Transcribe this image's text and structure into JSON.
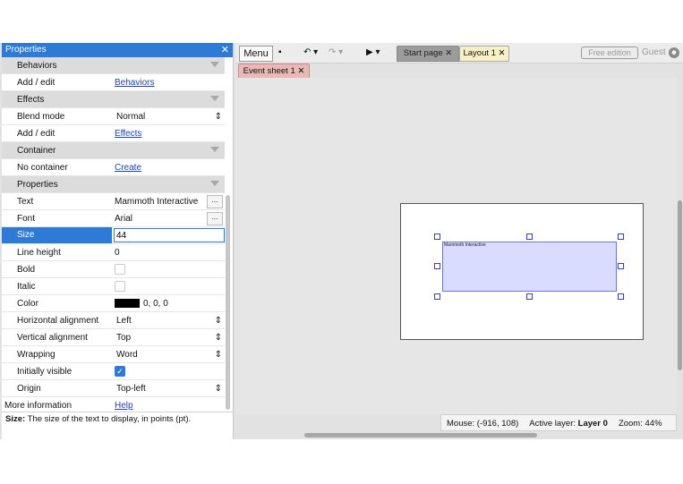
{
  "properties_panel": {
    "title": "Properties",
    "close_icon": "✕",
    "rows": [
      {
        "kind": "section",
        "label": "Behaviors"
      },
      {
        "kind": "link",
        "label": "Add / edit",
        "value": "Behaviors"
      },
      {
        "kind": "section",
        "label": "Effects"
      },
      {
        "kind": "select",
        "label": "Blend mode",
        "value": "Normal"
      },
      {
        "kind": "link",
        "label": "Add / edit",
        "value": "Effects"
      },
      {
        "kind": "section",
        "label": "Container"
      },
      {
        "kind": "link",
        "label": "No container",
        "value": "Create"
      },
      {
        "kind": "section",
        "label": "Properties"
      },
      {
        "kind": "text-ellipsis",
        "label": "Text",
        "value": "Mammoth Interactive"
      },
      {
        "kind": "text-ellipsis",
        "label": "Font",
        "value": "Arial"
      },
      {
        "kind": "input-selected",
        "label": "Size",
        "value": "44"
      },
      {
        "kind": "text",
        "label": "Line height",
        "value": "0"
      },
      {
        "kind": "checkbox",
        "label": "Bold",
        "checked": false
      },
      {
        "kind": "checkbox",
        "label": "Italic",
        "checked": false
      },
      {
        "kind": "color",
        "label": "Color",
        "value": "0, 0, 0"
      },
      {
        "kind": "select",
        "label": "Horizontal alignment",
        "value": "Left"
      },
      {
        "kind": "select",
        "label": "Vertical alignment",
        "value": "Top"
      },
      {
        "kind": "select",
        "label": "Wrapping",
        "value": "Word"
      },
      {
        "kind": "checkbox",
        "label": "Initially visible",
        "checked": true
      },
      {
        "kind": "select",
        "label": "Origin",
        "value": "Top-left"
      },
      {
        "kind": "link-outdent",
        "label": "More information",
        "value": "Help"
      }
    ],
    "description": {
      "term": "Size:",
      "text": " The size of the text to display, in points (pt)."
    }
  },
  "toolbar": {
    "menu_label": "Menu",
    "save_icon": "▪",
    "undo_icon": "↶ ▾",
    "redo_icon": "↷ ▾",
    "play_icon": "▶ ▾",
    "tabs": [
      {
        "label": "Start page ✕"
      },
      {
        "label": "Layout 1 ✕"
      }
    ],
    "edition_badge": "Free edition",
    "user_label": "Guest",
    "user_icon": "☻"
  },
  "subtabs": [
    {
      "label": "Event sheet 1 ✕"
    }
  ],
  "canvas": {
    "text_object_label": "Mammoth Interactive"
  },
  "status_bar": {
    "mouse": "Mouse: (-916, 108)",
    "layer_prefix": "Active layer: ",
    "layer": "Layer 0",
    "zoom": "Zoom: 44%"
  },
  "colors": {
    "accent": "#2d7bd6",
    "event_tab": "#e8b9b5",
    "layout_tab": "#f6f0c4",
    "object_fill": "#d9dcff"
  }
}
